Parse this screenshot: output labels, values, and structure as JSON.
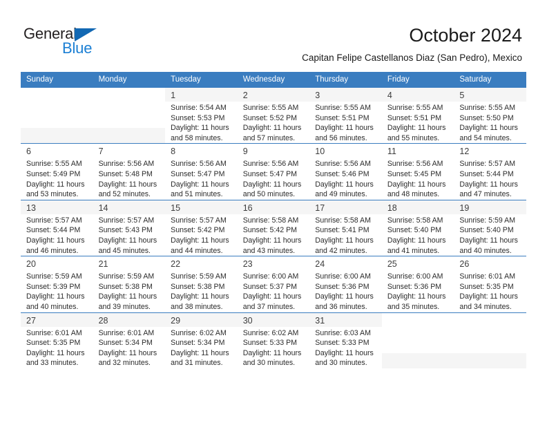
{
  "brand": {
    "name_part1": "General",
    "name_part2": "Blue",
    "triangle_color": "#1268b3",
    "blue_color": "#1b7fd4"
  },
  "header": {
    "title": "October 2024",
    "subtitle": "Capitan Felipe Castellanos Diaz (San Pedro), Mexico",
    "header_bg": "#3a7dc0"
  },
  "calendar": {
    "weekday_headers": [
      "Sunday",
      "Monday",
      "Tuesday",
      "Wednesday",
      "Thursday",
      "Friday",
      "Saturday"
    ],
    "weeks": [
      [
        {
          "day": "",
          "lines": []
        },
        {
          "day": "",
          "lines": []
        },
        {
          "day": "1",
          "lines": [
            "Sunrise: 5:54 AM",
            "Sunset: 5:53 PM",
            "Daylight: 11 hours",
            "and 58 minutes."
          ]
        },
        {
          "day": "2",
          "lines": [
            "Sunrise: 5:55 AM",
            "Sunset: 5:52 PM",
            "Daylight: 11 hours",
            "and 57 minutes."
          ]
        },
        {
          "day": "3",
          "lines": [
            "Sunrise: 5:55 AM",
            "Sunset: 5:51 PM",
            "Daylight: 11 hours",
            "and 56 minutes."
          ]
        },
        {
          "day": "4",
          "lines": [
            "Sunrise: 5:55 AM",
            "Sunset: 5:51 PM",
            "Daylight: 11 hours",
            "and 55 minutes."
          ]
        },
        {
          "day": "5",
          "lines": [
            "Sunrise: 5:55 AM",
            "Sunset: 5:50 PM",
            "Daylight: 11 hours",
            "and 54 minutes."
          ]
        }
      ],
      [
        {
          "day": "6",
          "lines": [
            "Sunrise: 5:55 AM",
            "Sunset: 5:49 PM",
            "Daylight: 11 hours",
            "and 53 minutes."
          ]
        },
        {
          "day": "7",
          "lines": [
            "Sunrise: 5:56 AM",
            "Sunset: 5:48 PM",
            "Daylight: 11 hours",
            "and 52 minutes."
          ]
        },
        {
          "day": "8",
          "lines": [
            "Sunrise: 5:56 AM",
            "Sunset: 5:47 PM",
            "Daylight: 11 hours",
            "and 51 minutes."
          ]
        },
        {
          "day": "9",
          "lines": [
            "Sunrise: 5:56 AM",
            "Sunset: 5:47 PM",
            "Daylight: 11 hours",
            "and 50 minutes."
          ]
        },
        {
          "day": "10",
          "lines": [
            "Sunrise: 5:56 AM",
            "Sunset: 5:46 PM",
            "Daylight: 11 hours",
            "and 49 minutes."
          ]
        },
        {
          "day": "11",
          "lines": [
            "Sunrise: 5:56 AM",
            "Sunset: 5:45 PM",
            "Daylight: 11 hours",
            "and 48 minutes."
          ]
        },
        {
          "day": "12",
          "lines": [
            "Sunrise: 5:57 AM",
            "Sunset: 5:44 PM",
            "Daylight: 11 hours",
            "and 47 minutes."
          ]
        }
      ],
      [
        {
          "day": "13",
          "lines": [
            "Sunrise: 5:57 AM",
            "Sunset: 5:44 PM",
            "Daylight: 11 hours",
            "and 46 minutes."
          ]
        },
        {
          "day": "14",
          "lines": [
            "Sunrise: 5:57 AM",
            "Sunset: 5:43 PM",
            "Daylight: 11 hours",
            "and 45 minutes."
          ]
        },
        {
          "day": "15",
          "lines": [
            "Sunrise: 5:57 AM",
            "Sunset: 5:42 PM",
            "Daylight: 11 hours",
            "and 44 minutes."
          ]
        },
        {
          "day": "16",
          "lines": [
            "Sunrise: 5:58 AM",
            "Sunset: 5:42 PM",
            "Daylight: 11 hours",
            "and 43 minutes."
          ]
        },
        {
          "day": "17",
          "lines": [
            "Sunrise: 5:58 AM",
            "Sunset: 5:41 PM",
            "Daylight: 11 hours",
            "and 42 minutes."
          ]
        },
        {
          "day": "18",
          "lines": [
            "Sunrise: 5:58 AM",
            "Sunset: 5:40 PM",
            "Daylight: 11 hours",
            "and 41 minutes."
          ]
        },
        {
          "day": "19",
          "lines": [
            "Sunrise: 5:59 AM",
            "Sunset: 5:40 PM",
            "Daylight: 11 hours",
            "and 40 minutes."
          ]
        }
      ],
      [
        {
          "day": "20",
          "lines": [
            "Sunrise: 5:59 AM",
            "Sunset: 5:39 PM",
            "Daylight: 11 hours",
            "and 40 minutes."
          ]
        },
        {
          "day": "21",
          "lines": [
            "Sunrise: 5:59 AM",
            "Sunset: 5:38 PM",
            "Daylight: 11 hours",
            "and 39 minutes."
          ]
        },
        {
          "day": "22",
          "lines": [
            "Sunrise: 5:59 AM",
            "Sunset: 5:38 PM",
            "Daylight: 11 hours",
            "and 38 minutes."
          ]
        },
        {
          "day": "23",
          "lines": [
            "Sunrise: 6:00 AM",
            "Sunset: 5:37 PM",
            "Daylight: 11 hours",
            "and 37 minutes."
          ]
        },
        {
          "day": "24",
          "lines": [
            "Sunrise: 6:00 AM",
            "Sunset: 5:36 PM",
            "Daylight: 11 hours",
            "and 36 minutes."
          ]
        },
        {
          "day": "25",
          "lines": [
            "Sunrise: 6:00 AM",
            "Sunset: 5:36 PM",
            "Daylight: 11 hours",
            "and 35 minutes."
          ]
        },
        {
          "day": "26",
          "lines": [
            "Sunrise: 6:01 AM",
            "Sunset: 5:35 PM",
            "Daylight: 11 hours",
            "and 34 minutes."
          ]
        }
      ],
      [
        {
          "day": "27",
          "lines": [
            "Sunrise: 6:01 AM",
            "Sunset: 5:35 PM",
            "Daylight: 11 hours",
            "and 33 minutes."
          ]
        },
        {
          "day": "28",
          "lines": [
            "Sunrise: 6:01 AM",
            "Sunset: 5:34 PM",
            "Daylight: 11 hours",
            "and 32 minutes."
          ]
        },
        {
          "day": "29",
          "lines": [
            "Sunrise: 6:02 AM",
            "Sunset: 5:34 PM",
            "Daylight: 11 hours",
            "and 31 minutes."
          ]
        },
        {
          "day": "30",
          "lines": [
            "Sunrise: 6:02 AM",
            "Sunset: 5:33 PM",
            "Daylight: 11 hours",
            "and 30 minutes."
          ]
        },
        {
          "day": "31",
          "lines": [
            "Sunrise: 6:03 AM",
            "Sunset: 5:33 PM",
            "Daylight: 11 hours",
            "and 30 minutes."
          ]
        },
        {
          "day": "",
          "lines": []
        },
        {
          "day": "",
          "lines": []
        }
      ]
    ]
  }
}
